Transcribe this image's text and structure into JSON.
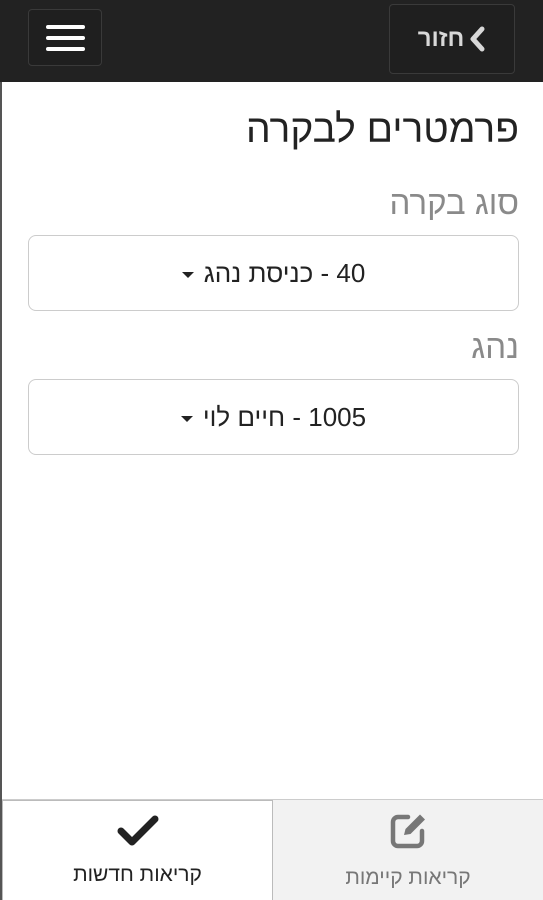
{
  "header": {
    "back_label": "חזור",
    "back_icon": "chevron-left-icon",
    "menu_icon": "hamburger-menu-icon"
  },
  "page": {
    "title": "פרמטרים לבקרה"
  },
  "fields": {
    "inspection_type": {
      "label": "סוג בקרה",
      "value": "40 - כניסת נהג"
    },
    "driver": {
      "label": "נהג",
      "value": "1005 - חיים לוי"
    }
  },
  "bottom_tabs": {
    "new_calls": {
      "label": "קריאות חדשות",
      "icon": "checkmark-icon"
    },
    "existing_calls": {
      "label": "קריאות קיימות",
      "icon": "edit-icon"
    }
  },
  "colors": {
    "topbar": "#222222",
    "label_gray": "#8a8a8a",
    "inactive_tab": "#f2f2f2"
  }
}
